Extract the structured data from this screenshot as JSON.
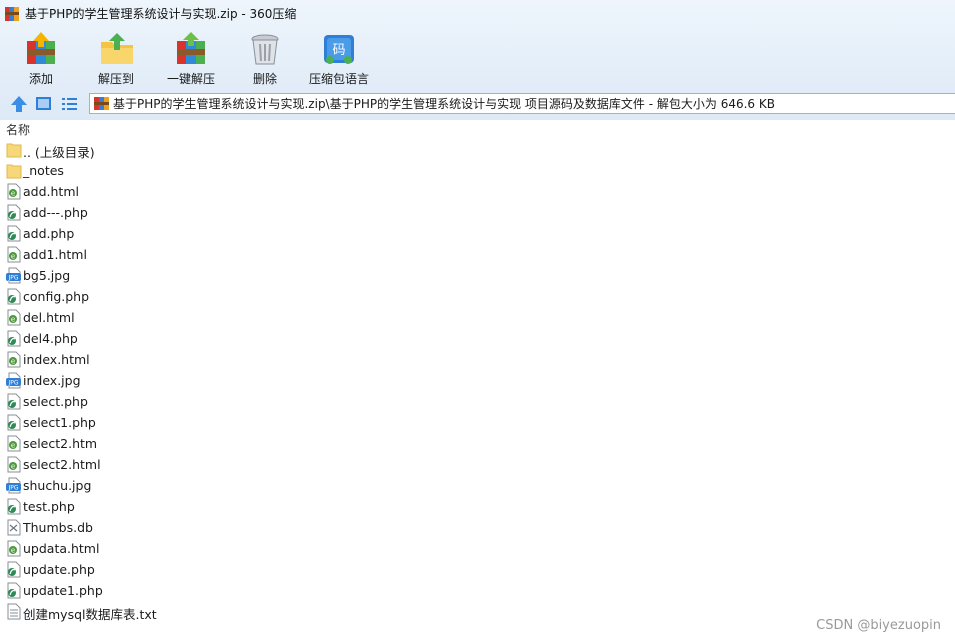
{
  "window": {
    "title": "基于PHP的学生管理系统设计与实现.zip - 360压缩"
  },
  "toolbar": {
    "add": "添加",
    "extract_to": "解压到",
    "one_click_extract": "一键解压",
    "delete": "删除",
    "archive_language": "压缩包语言",
    "archive_language_glyph": "码"
  },
  "nav": {
    "path": "基于PHP的学生管理系统设计与实现.zip\\基于PHP的学生管理系统设计与实现 项目源码及数据库文件 - 解包大小为 646.6 KB"
  },
  "list": {
    "column_name": "名称",
    "files": [
      {
        "name": ".. (上级目录)",
        "icon": "folder-icon"
      },
      {
        "name": "_notes",
        "icon": "folder-icon"
      },
      {
        "name": "add.html",
        "icon": "html-file-icon"
      },
      {
        "name": "add---.php",
        "icon": "php-file-icon"
      },
      {
        "name": "add.php",
        "icon": "php-file-icon"
      },
      {
        "name": "add1.html",
        "icon": "html-file-icon"
      },
      {
        "name": "bg5.jpg",
        "icon": "jpg-file-icon"
      },
      {
        "name": "config.php",
        "icon": "php-file-icon"
      },
      {
        "name": "del.html",
        "icon": "html-file-icon"
      },
      {
        "name": "del4.php",
        "icon": "php-file-icon"
      },
      {
        "name": "index.html",
        "icon": "html-file-icon"
      },
      {
        "name": "index.jpg",
        "icon": "jpg-file-icon"
      },
      {
        "name": "select.php",
        "icon": "php-file-icon"
      },
      {
        "name": "select1.php",
        "icon": "php-file-icon"
      },
      {
        "name": "select2.htm",
        "icon": "html-file-icon"
      },
      {
        "name": "select2.html",
        "icon": "html-file-icon"
      },
      {
        "name": "shuchu.jpg",
        "icon": "jpg-file-icon"
      },
      {
        "name": "test.php",
        "icon": "php-file-icon"
      },
      {
        "name": "Thumbs.db",
        "icon": "db-file-icon"
      },
      {
        "name": "updata.html",
        "icon": "html-file-icon"
      },
      {
        "name": "update.php",
        "icon": "php-file-icon"
      },
      {
        "name": "update1.php",
        "icon": "php-file-icon"
      },
      {
        "name": "创建mysql数据库表.txt",
        "icon": "txt-file-icon"
      }
    ]
  },
  "watermark": "CSDN @biyezuopin",
  "colors": {
    "chrome_top": "#eef5fc",
    "chrome_bottom": "#dde9f6",
    "accent": "#2f7fd6"
  }
}
